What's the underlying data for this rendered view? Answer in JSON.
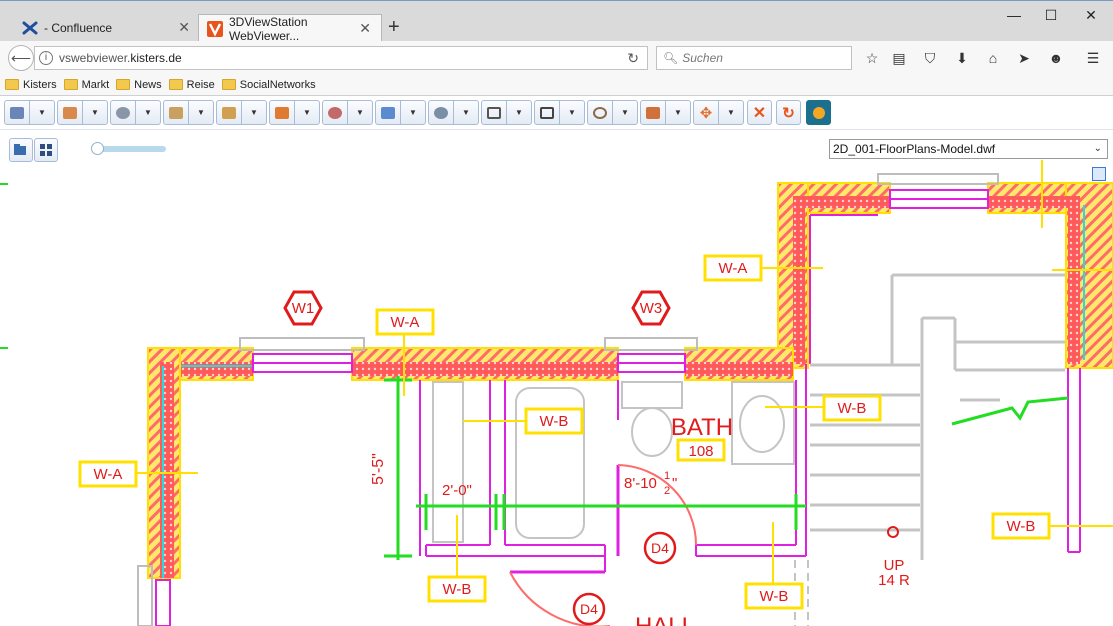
{
  "browser": {
    "tabs": [
      {
        "label": "- Confluence",
        "icon": "confluence-icon",
        "active": false
      },
      {
        "label": "3DViewStation WebViewer...",
        "icon": "viewstation-icon",
        "active": true
      }
    ],
    "url_prefix": "vswebviewer.",
    "url_host": "kisters.de",
    "search_placeholder": "Suchen",
    "bookmarks": [
      "Kisters",
      "Markt",
      "News",
      "Reise",
      "SocialNetworks"
    ]
  },
  "viewer": {
    "file_selected": "2D_001-FloorPlans-Model.dwf",
    "toolbar_groups": [
      "selection-tool",
      "model-tree-tool",
      "camera-tool",
      "views-tool",
      "measure-tool",
      "section-tool",
      "transform-tool",
      "axis-tool",
      "zoom-tool",
      "box-view-tool",
      "render-mode-tool",
      "markup-tool",
      "material-tool",
      "move-tool"
    ],
    "toolbar_singles": [
      "close-x-icon",
      "reset-icon",
      "viewstation-logo-icon"
    ]
  },
  "drawing": {
    "labels": {
      "wa1": "W-A",
      "wa2": "W-A",
      "wa3": "W-A",
      "wb1": "W-B",
      "wb2": "W-B",
      "wb3": "W-B",
      "wb4": "W-B",
      "wb5": "W-B",
      "w1": "W1",
      "w3": "W3",
      "bath": "BATH",
      "room": "108",
      "dim_vertical": "5'-5\"",
      "dim_2ft": "2'-0\"",
      "dim_8ft": "8'-10 1/2\"",
      "dim_8ft_main": "8'-10",
      "dim_8ft_frac_num": "1",
      "dim_8ft_frac_den": "2",
      "dim_8ft_inch": "\"",
      "d4a": "D4",
      "d4b": "D4",
      "up": "UP",
      "riser": "14 R",
      "hall": "HALL"
    }
  },
  "colors": {
    "wall_red": "#ff5a5a",
    "wall_yellow": "#ffe000",
    "magenta": "#e020e0",
    "green": "#22dd22",
    "cyan": "#22dddd",
    "label_red": "#e01b1b"
  }
}
